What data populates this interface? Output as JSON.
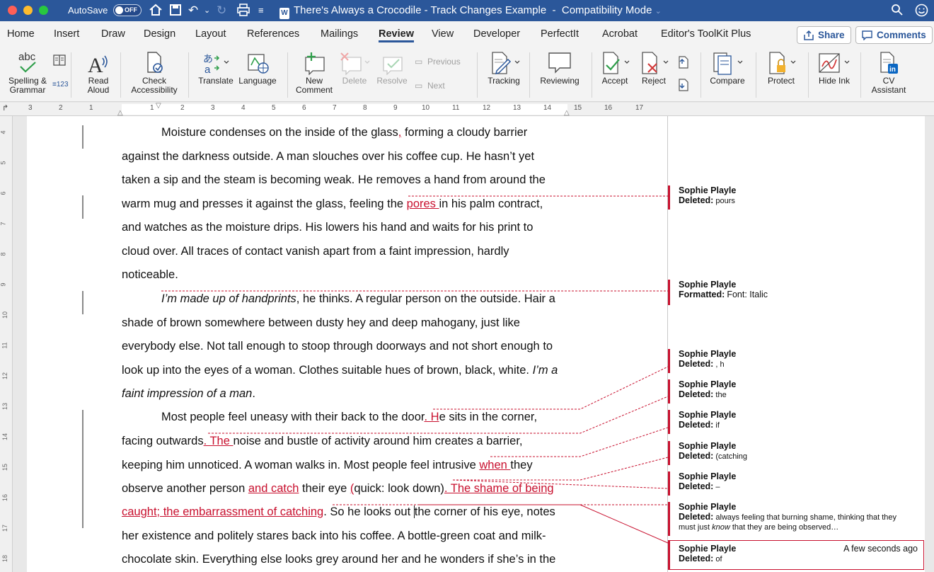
{
  "titlebar": {
    "autosave_label": "AutoSave",
    "autosave_state": "OFF",
    "document_title": "There's Always a Crocodile - Track Changes Example",
    "mode": "Compatibility Mode"
  },
  "tabs": [
    "Home",
    "Insert",
    "Draw",
    "Design",
    "Layout",
    "References",
    "Mailings",
    "Review",
    "View",
    "Developer",
    "PerfectIt",
    "Acrobat",
    "Editor's ToolKit Plus"
  ],
  "active_tab": "Review",
  "share_label": "Share",
  "comments_label": "Comments",
  "ribbon": {
    "spelling": [
      "Spelling &",
      "Grammar"
    ],
    "read_aloud": [
      "Read",
      "Aloud"
    ],
    "check_accessibility": [
      "Check",
      "Accessibility"
    ],
    "translate": "Translate",
    "language": "Language",
    "new_comment": [
      "New",
      "Comment"
    ],
    "delete": "Delete",
    "resolve": "Resolve",
    "previous": "Previous",
    "next": "Next",
    "tracking": "Tracking",
    "reviewing": "Reviewing",
    "accept": "Accept",
    "reject": "Reject",
    "compare": "Compare",
    "protect": "Protect",
    "hide_ink": "Hide Ink",
    "cv_assistant": [
      "CV",
      "Assistant"
    ]
  },
  "ruler_numbers": [
    "3",
    "2",
    "1",
    "1",
    "2",
    "3",
    "4",
    "5",
    "6",
    "7",
    "8",
    "9",
    "10",
    "11",
    "12",
    "13",
    "14",
    "15",
    "16",
    "17"
  ],
  "vruler_numbers": [
    "4",
    "5",
    "6",
    "7",
    "8",
    "9",
    "10",
    "11",
    "12",
    "13",
    "14",
    "15",
    "16",
    "17",
    "18"
  ],
  "body": {
    "l1a": "Moisture condenses on the inside of the glass",
    "l1b": ",",
    "l1c": " forming a cloudy barrier",
    "l2": "against the darkness outside. A man slouches over his coffee cup. He hasn’t yet",
    "l3": "taken a sip and the steam is becoming weak. He removes a hand from around the",
    "l4a": "warm mug and presses it against the glass, feeling the ",
    "l4b": "pores ",
    "l4c": "in his palm contract,",
    "l5": "and watches as the moisture drips. His lowers his hand and waits for his print to",
    "l6": "cloud over. All traces of contact vanish apart from a faint impression, hardly",
    "l7": "noticeable.",
    "l8a": "I’m made up of handprints",
    "l8b": ", he thinks. A regular person on the outside. Hair a",
    "l9": "shade of brown somewhere between dusty hey and deep mahogany, just like",
    "l10": "everybody else. Not tall enough to stoop through doorways and not short enough to",
    "l11a": "look up into the eyes of a woman. Clothes suitable hues of brown, black, white. ",
    "l11b": "I’m a",
    "l12a": "faint impression of a man",
    "l12b": ".",
    "l13a": "Most people feel uneasy with their back to the door",
    "l13b": ". H",
    "l13c": "e sits in the corner,",
    "l14a": "facing outwards",
    "l14b": ". The ",
    "l14c": "noise and bustle of activity around him creates a barrier,",
    "l15a": "keeping him unnoticed. A woman walks in. Most people feel intrusive ",
    "l15b": "when ",
    "l15c": "they",
    "l16a": "observe another person ",
    "l16b": "and catch",
    "l16c": " their eye ",
    "l16d": "(",
    "l16e": "quick: look down)",
    "l16f": ". The shame of being",
    "l17a": "caught; the embarrassment of catching",
    "l17b": ". So he looks out ",
    "l17c": "the corner of his eye, notes",
    "l18": "her existence and politely stares back into his coffee. A bottle-green coat and milk-",
    "l19": "chocolate skin. Everything else looks grey around her and he wonders if she’s in the"
  },
  "balloons": [
    {
      "author": "Sophie Playle",
      "label": "Deleted:",
      "text": "pours"
    },
    {
      "author": "Sophie Playle",
      "label": "Formatted:",
      "text": "Font: Italic"
    },
    {
      "author": "Sophie Playle",
      "label": "Deleted:",
      "text": ", h"
    },
    {
      "author": "Sophie Playle",
      "label": "Deleted:",
      "text": "the"
    },
    {
      "author": "Sophie Playle",
      "label": "Deleted:",
      "text": "if"
    },
    {
      "author": "Sophie Playle",
      "label": "Deleted:",
      "text": "(catching"
    },
    {
      "author": "Sophie Playle",
      "label": "Deleted:",
      "text": "–"
    },
    {
      "author": "Sophie Playle",
      "label": "Deleted:",
      "text_a": " always feeling that burning shame, thinking that they",
      "text_b": "must just ",
      "text_c": "know",
      "text_d": " that they are being observed…"
    },
    {
      "author": "Sophie Playle",
      "label": "Deleted:",
      "text": "of",
      "timestamp": "A few seconds ago"
    }
  ],
  "colors": {
    "word_blue": "#2b579a",
    "revision_red": "#c8102e"
  }
}
